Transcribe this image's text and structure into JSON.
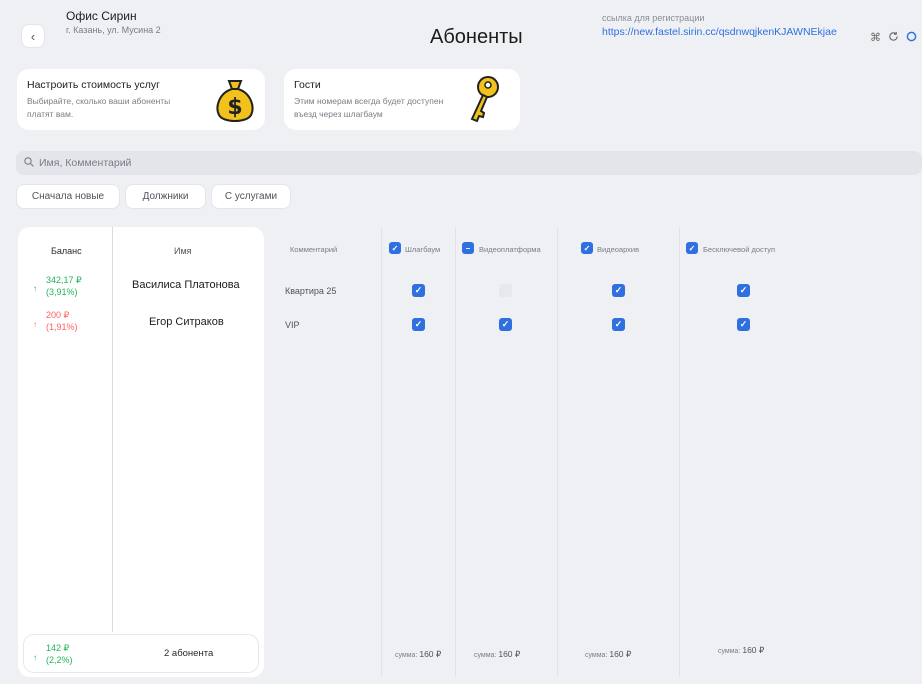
{
  "header": {
    "office_name": "Офис Сирин",
    "office_address": "г. Казань, ул. Мусина 2",
    "title": "Абоненты",
    "registration_label": "ссылка для регистрации",
    "registration_link": "https://new.fastel.sirin.cc/qsdnwqjkenKJAWNEkjae",
    "back_symbol": "‹",
    "icons": [
      "command-icon",
      "sync-icon",
      "circle-icon"
    ]
  },
  "cards": [
    {
      "title": "Настроить стоимость услуг",
      "description": "Выбирайте, сколько ваши абоненты платят вам.",
      "icon": "money-bag-icon"
    },
    {
      "title": "Гости",
      "description": "Этим номерам всегда будет доступен въезд через шлагбаум",
      "icon": "key-icon"
    }
  ],
  "search": {
    "placeholder": "Имя, Комментарий"
  },
  "filters": [
    "Сначала новые",
    "Должники",
    "С услугами"
  ],
  "table": {
    "headers": {
      "balance": "Баланс",
      "name": "Имя",
      "comment": "Комментарий",
      "services": [
        "Шлагбаум",
        "Видеоплатформа",
        "Видеоархив",
        "Бесключевой доступ"
      ]
    },
    "rows": [
      {
        "balance": "342,17 ₽",
        "percent": "(3,91%)",
        "trend": "up",
        "name": "Василиса Платонова",
        "comment": "Квартира 25",
        "services": [
          true,
          false,
          true,
          true
        ]
      },
      {
        "balance": "200 ₽",
        "percent": "(1,91%)",
        "trend": "up",
        "name": "Егор Ситраков",
        "comment": "VIP",
        "services": [
          true,
          true,
          true,
          true
        ]
      }
    ],
    "footer": {
      "balance": "142 ₽",
      "percent": "(2,2%)",
      "count": "2 абонента",
      "sum_label": "сумма:",
      "sums": [
        "160 ₽",
        "160 ₽",
        "160 ₽",
        "160 ₽"
      ]
    }
  },
  "colors": {
    "accent": "#2f6fe0",
    "positive": "#24b35a",
    "negative": "#ff5f5f"
  }
}
